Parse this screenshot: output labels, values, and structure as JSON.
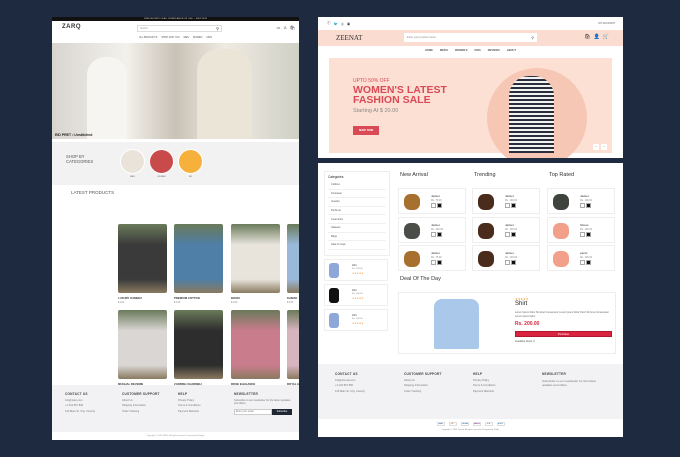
{
  "zarq": {
    "announcement": "FREE DELIVERY ON ALL ORDERS ABOVE RS. 5000 — SHOP NOW",
    "logo": "ZARQ",
    "search_placeholder": "Search",
    "nav": [
      "ALL PRODUCTS",
      "SHOP FOR YOU",
      "MEN",
      "WOMEN",
      "KIDS"
    ],
    "cart_count": "0",
    "hero_caption": "EID PRET • Unstitched",
    "categories_title": "SHOP BY CATEGORIES",
    "categories": [
      {
        "label": "MEN",
        "color": "#e9e3da"
      },
      {
        "label": "WOMEN",
        "color": "#c84a4a"
      },
      {
        "label": "KID",
        "color": "#f6b13c"
      }
    ],
    "latest_title": "LATEST PRODUCTS",
    "products": [
      {
        "name": "LUXURY KAMEEZ",
        "price": "$ 100",
        "color": "#3a3a3a"
      },
      {
        "name": "PREMIUM COTTON",
        "price": "$ 100",
        "color": "#4f7ea6"
      },
      {
        "name": "BOSKI",
        "price": "$ 100",
        "color": "#e8e4dc"
      },
      {
        "name": "KAMAK",
        "price": "$ 100",
        "color": "#9ab9d9"
      },
      {
        "name": "MUGHAL REVERIE",
        "price": "$ 100",
        "color": "#d9d6d4"
      },
      {
        "name": "ZARRISH CHARMELI",
        "price": "$ 100",
        "color": "#2d2d2d"
      },
      {
        "name": "ROSE ELEGANCE",
        "price": "$ 100",
        "color": "#c97c8c"
      },
      {
        "name": "ROYAL HEIRLOOM",
        "price": "$ 100",
        "color": "#d7b5bf"
      }
    ],
    "footer": {
      "contact": {
        "title": "CONTACT US",
        "items": [
          "info@zarq.com",
          "+1 234 567 890",
          "123 Main St, City, Country"
        ]
      },
      "support": {
        "title": "CUSTOMER SUPPORT",
        "items": [
          "About Us",
          "Shipping Information",
          "Order Tracking"
        ]
      },
      "help": {
        "title": "HELP",
        "items": [
          "Privacy Policy",
          "Terms & Conditions",
          "Payment Methods"
        ]
      },
      "newsletter": {
        "title": "NEWSLETTER",
        "text": "Subscribe to our newsletter for the latest updates and offers.",
        "placeholder": "Enter your email",
        "button": "Subscribe"
      },
      "copyright": "Copyright © 2024 ZARQ. All rights reserved. Powered by Shopify."
    }
  },
  "zeenat": {
    "account": "MY ACCOUNT",
    "logo": "ZEENAT",
    "search_placeholder": "Enter your product name...",
    "cart_count": "0",
    "nav": [
      "HOME",
      "MEN'S",
      "WOMEN'S",
      "KIDS",
      "REVIEWS",
      "ABOUT"
    ],
    "banner": {
      "kicker": "UPTO 50% OFF",
      "title1": "WOMEN'S LATEST",
      "title2": "FASHION SALE",
      "sub": "Starting At $ 20.00",
      "button": "SHOP NOW"
    },
    "categories_title": "Categories",
    "categories": [
      "Clothes",
      "Footwear",
      "Jewelry",
      "Perfume",
      "Cosmetics",
      "Glasses",
      "Bags",
      "Hats & Caps"
    ],
    "side_products": [
      {
        "name": "shirt",
        "price": "Rs. 200.00",
        "rating": "★★★★★",
        "color": "#8fa7d8"
      },
      {
        "name": "shirt",
        "price": "Rs. 150.00",
        "rating": "★★★★★",
        "color": "#111"
      },
      {
        "name": "shirt",
        "price": "Rs. 200.00",
        "rating": "★★★★★",
        "color": "#8fa7d8"
      }
    ],
    "columns": [
      {
        "title": "New Arrival",
        "items": [
          {
            "name": "Jacket",
            "price": "Rs. 75.00",
            "color": "#a8702f"
          },
          {
            "name": "Jacket",
            "price": "Rs. 100.00",
            "color": "#4a4d48"
          },
          {
            "name": "Jacket",
            "price": "Rs. 75.00",
            "color": "#a8702f"
          }
        ]
      },
      {
        "title": "Trending",
        "items": [
          {
            "name": "Jacket",
            "price": "Rs. 100.00",
            "color": "#4a2c1d"
          },
          {
            "name": "Jacket",
            "price": "Rs. 100.00",
            "color": "#4a2c1d"
          },
          {
            "name": "Jacket",
            "price": "Rs. 100.00",
            "color": "#4a2c1d"
          }
        ]
      },
      {
        "title": "Top Rated",
        "items": [
          {
            "name": "Jacket",
            "price": "Rs. 100.00",
            "color": "#3f453d"
          },
          {
            "name": "Shoes",
            "price": "Rs. 125.00",
            "color": "#f2a08a"
          },
          {
            "name": "pants",
            "price": "Rs. 125.00",
            "color": "#f2a08a"
          }
        ]
      }
    ],
    "deal": {
      "title": "Deal Of The Day",
      "rating": "★★★★★",
      "name": "Shirt",
      "desc": "Lorem Ipsum Dolor Sit Amet Consectetur Lorem Ipsum Dolor Dolor Sit Amet Consectetur Lorem Ipsum Dolor",
      "price": "Rs. 200.00",
      "button": "Purchase",
      "stock": "Available Stock: 6"
    },
    "footer": {
      "contact": {
        "title": "CONTACT US",
        "items": [
          "info@zeenat.com",
          "+1 234 567 890",
          "123 Main St, City, Country"
        ]
      },
      "support": {
        "title": "CUSTOMER SUPPORT",
        "items": [
          "About Us",
          "Shipping Information",
          "Order Tracking"
        ]
      },
      "help": {
        "title": "HELP",
        "items": [
          "Privacy Policy",
          "Terms & Conditions",
          "Payment Methods"
        ]
      },
      "newsletter": {
        "title": "NEWSLETTER",
        "text": "Subscribe to our newsletter for the latest updates and offers."
      },
      "payments": [
        "VISA",
        "MC",
        "PAYPAL",
        "SKRILL",
        "JCB",
        "AMEX"
      ],
      "copyright": "Copyright © 2024 Zeenat. All rights reserved. Designed by Coder"
    }
  },
  "colors": {
    "bg": "#1d2a40",
    "accent": "#d94a56",
    "peach": "#fbdcd0"
  }
}
